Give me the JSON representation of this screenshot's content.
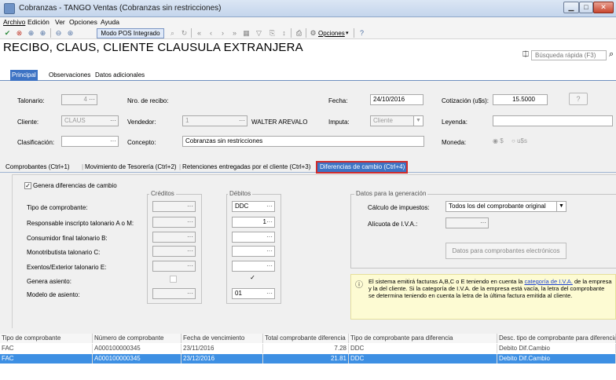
{
  "window": {
    "title": "Cobranzas - TANGO Ventas (Cobranzas sin restricciones)",
    "min": "▁",
    "max": "□",
    "close": "✕"
  },
  "menu": [
    "Archivo",
    "Edición",
    "Ver",
    "Opciones",
    "Ayuda"
  ],
  "toolbar": {
    "pos_label": "Modo POS Integrado",
    "options_label": "Opciones"
  },
  "header": {
    "title": "RECIBO,  CLAUS, CLIENTE CLAUSULA EXTRANJERA",
    "search_placeholder": "Búsqueda rápida (F3)"
  },
  "tabs": [
    "Principal",
    "Observaciones",
    "Datos adicionales"
  ],
  "form": {
    "talonario_label": "Talonario:",
    "talonario_value": "4",
    "nro_recibo_label": "Nro. de recibo:",
    "fecha_label": "Fecha:",
    "fecha_value": "24/10/2016",
    "cotizacion_label": "Cotización (u$s):",
    "cotizacion_value": "15.5000",
    "cliente_label": "Cliente:",
    "cliente_value": "CLAUS",
    "vendedor_label": "Vendedor:",
    "vendedor_code": "1",
    "vendedor_name": "WALTER AREVALO",
    "imputa_label": "Imputa:",
    "imputa_value": "Cliente",
    "leyenda_label": "Leyenda:",
    "clasificacion_label": "Clasificación:",
    "concepto_label": "Concepto:",
    "concepto_value": "Cobranzas sin restricciones",
    "moneda_label": "Moneda:",
    "moneda_opt1": "$",
    "moneda_opt2": "u$s"
  },
  "subtabs": [
    "Comprobantes (Ctrl+1)",
    "Movimiento de Tesorería (Ctrl+2)",
    "Retenciones entregadas por el cliente (Ctrl+3)",
    "Diferencias de cambio (Ctrl+4)"
  ],
  "diferencias": {
    "genera_label": "Genera diferencias de cambio",
    "creditos_label": "Créditos",
    "debitos_label": "Débitos",
    "rows": [
      "Tipo de comprobante:",
      "Responsable inscripto talonario A o M:",
      "Consumidor final talonario B:",
      "Monotributista talonario C:",
      "Exentos/Exterior talonario E:",
      "Genera asiento:",
      "Modelo de asiento:"
    ],
    "debitos_tipo": "DDC",
    "debitos_resp": "1",
    "debitos_modelo": "01",
    "datos_label": "Datos para la generación",
    "calculo_label": "Cálculo de impuestos:",
    "calculo_value": "Todos los del comprobante original",
    "alicuota_label": "Alícuota de I.V.A.:",
    "electronicos_btn": "Datos para comprobantes electrónicos",
    "info_text1": "El sistema emitirá facturas A,B,C o E teniendo en cuenta la ",
    "info_link": "categoría de I.V.A.",
    "info_text2": " de la empresa y la del cliente. Si la categoría de I.V.A. de la empresa está vacía, la letra del comprobante se determina teniendo en cuenta la letra de la última factura emitida al cliente."
  },
  "grid": {
    "headers": [
      "Tipo de comprobante",
      "Número de comprobante",
      "Fecha de vencimiento",
      "Total comprobante diferencia",
      "Tipo de comprobante para diferencia",
      "Desc. tipo de comprobante para diferencia"
    ],
    "rows": [
      [
        "FAC",
        "A000100000345",
        "23/11/2016",
        "7.28",
        "DDC",
        "Debito Dif.Cambio"
      ],
      [
        "FAC",
        "A000100000345",
        "23/12/2016",
        "21.81",
        "DDC",
        "Debito Dif.Cambio"
      ]
    ]
  }
}
